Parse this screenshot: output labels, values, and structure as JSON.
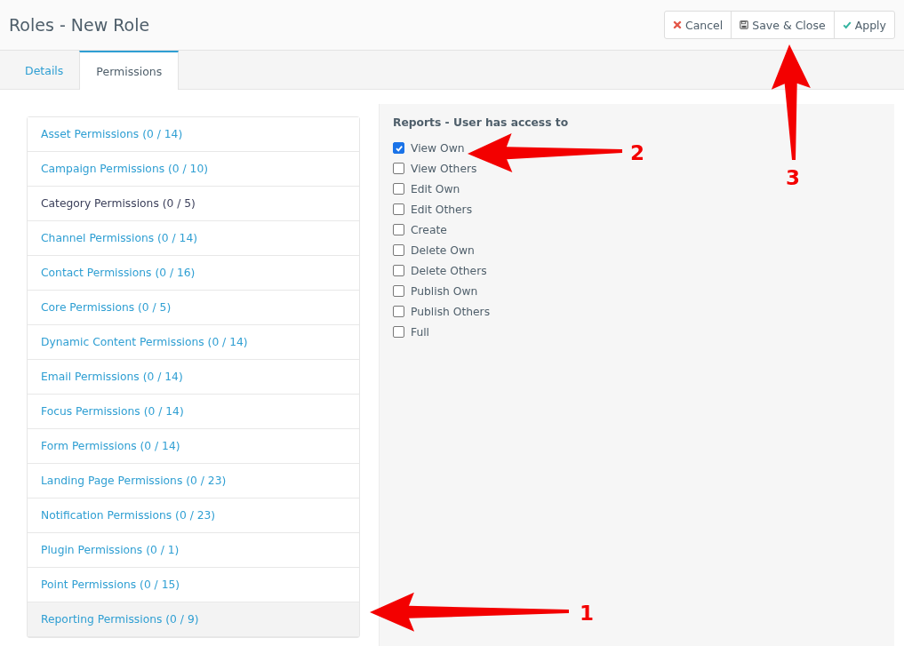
{
  "header": {
    "title": "Roles - New Role",
    "buttons": [
      {
        "label": "Cancel",
        "kind": "cancel"
      },
      {
        "label": "Save & Close",
        "kind": "save"
      },
      {
        "label": "Apply",
        "kind": "apply"
      }
    ]
  },
  "tabs": [
    {
      "label": "Details",
      "selected": false
    },
    {
      "label": "Permissions",
      "selected": true
    }
  ],
  "permission_groups": [
    {
      "label": "Asset Permissions (0 / 14)",
      "selected": false,
      "hovered": false
    },
    {
      "label": "Campaign Permissions (0 / 10)",
      "selected": false,
      "hovered": false
    },
    {
      "label": "Category Permissions (0 / 5)",
      "selected": false,
      "hovered": true
    },
    {
      "label": "Channel Permissions (0 / 14)",
      "selected": false,
      "hovered": false
    },
    {
      "label": "Contact Permissions (0 / 16)",
      "selected": false,
      "hovered": false
    },
    {
      "label": "Core Permissions (0 / 5)",
      "selected": false,
      "hovered": false
    },
    {
      "label": "Dynamic Content Permissions (0 / 14)",
      "selected": false,
      "hovered": false
    },
    {
      "label": "Email Permissions (0 / 14)",
      "selected": false,
      "hovered": false
    },
    {
      "label": "Focus Permissions (0 / 14)",
      "selected": false,
      "hovered": false
    },
    {
      "label": "Form Permissions (0 / 14)",
      "selected": false,
      "hovered": false
    },
    {
      "label": "Landing Page Permissions (0 / 23)",
      "selected": false,
      "hovered": false
    },
    {
      "label": "Notification Permissions (0 / 23)",
      "selected": false,
      "hovered": false
    },
    {
      "label": "Plugin Permissions (0 / 1)",
      "selected": false,
      "hovered": false
    },
    {
      "label": "Point Permissions (0 / 15)",
      "selected": false,
      "hovered": false
    },
    {
      "label": "Reporting Permissions (0 / 9)",
      "selected": true,
      "hovered": false
    }
  ],
  "permissions_panel": {
    "heading": "Reports - User has access to",
    "options": [
      {
        "label": "View Own",
        "checked": true
      },
      {
        "label": "View Others",
        "checked": false
      },
      {
        "label": "Edit Own",
        "checked": false
      },
      {
        "label": "Edit Others",
        "checked": false
      },
      {
        "label": "Create",
        "checked": false
      },
      {
        "label": "Delete Own",
        "checked": false
      },
      {
        "label": "Delete Others",
        "checked": false
      },
      {
        "label": "Publish Own",
        "checked": false
      },
      {
        "label": "Publish Others",
        "checked": false
      },
      {
        "label": "Full",
        "checked": false
      }
    ]
  },
  "annotations": [
    {
      "label": "1"
    },
    {
      "label": "2"
    },
    {
      "label": "3"
    }
  ]
}
